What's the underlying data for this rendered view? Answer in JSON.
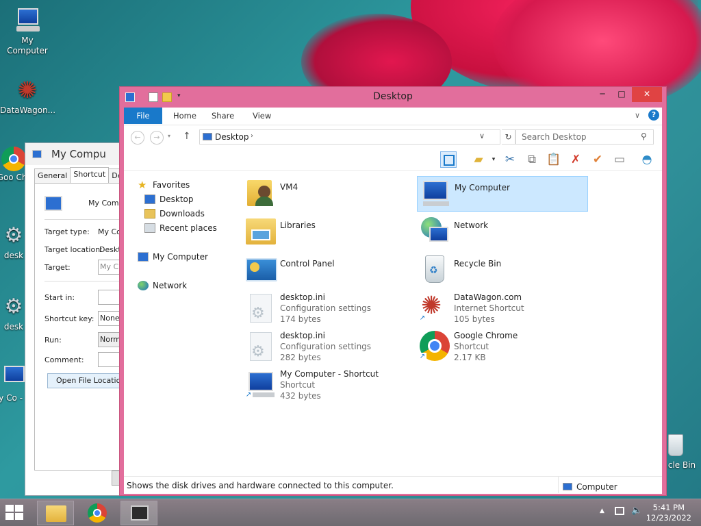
{
  "desktop": {
    "icons": [
      {
        "label": "My Computer",
        "icon": "computer-icon"
      },
      {
        "label": "DataWagon...",
        "icon": "datawagon-shortcut-icon"
      },
      {
        "label": "Goo Chr",
        "icon": "chrome-icon"
      },
      {
        "label": "desk",
        "icon": "settings-file-icon"
      },
      {
        "label": "desk",
        "icon": "settings-file-icon"
      },
      {
        "label": "My Co - Sh",
        "icon": "computer-shortcut-icon"
      },
      {
        "label": "cle Bin",
        "icon": "recycle-bin-icon"
      }
    ]
  },
  "properties": {
    "title": "My Compu",
    "tabs": [
      "General",
      "Shortcut",
      "Det"
    ],
    "name": "My Comp",
    "fields": {
      "target_type_label": "Target type:",
      "target_type": "My Co",
      "target_location_label": "Target location:",
      "target_location": "Deskt",
      "target_label": "Target:",
      "target": "My C",
      "start_in_label": "Start in:",
      "start_in": "",
      "shortcut_key_label": "Shortcut key:",
      "shortcut_key": "None",
      "run_label": "Run:",
      "run": "Norma",
      "comment_label": "Comment:",
      "comment": ""
    },
    "open_location_button": "Open File Location"
  },
  "explorer": {
    "title": "Desktop",
    "ribbon_tabs": [
      "File",
      "Home",
      "Share",
      "View"
    ],
    "address": "Desktop",
    "search_placeholder": "Search Desktop",
    "nav": {
      "favorites": "Favorites",
      "favorites_items": [
        "Desktop",
        "Downloads",
        "Recent places"
      ],
      "my_computer": "My Computer",
      "network": "Network"
    },
    "items": [
      {
        "name": "VM4",
        "type": "",
        "size": "",
        "icon": "user-folder-icon"
      },
      {
        "name": "My Computer",
        "type": "",
        "size": "",
        "icon": "computer-icon"
      },
      {
        "name": "Libraries",
        "type": "",
        "size": "",
        "icon": "libraries-icon"
      },
      {
        "name": "Network",
        "type": "",
        "size": "",
        "icon": "network-icon"
      },
      {
        "name": "Control Panel",
        "type": "",
        "size": "",
        "icon": "control-panel-icon"
      },
      {
        "name": "Recycle Bin",
        "type": "",
        "size": "",
        "icon": "recycle-bin-icon"
      },
      {
        "name": "desktop.ini",
        "type": "Configuration settings",
        "size": "174 bytes",
        "icon": "settings-file-icon"
      },
      {
        "name": "DataWagon.com",
        "type": "Internet Shortcut",
        "size": "105 bytes",
        "icon": "datawagon-shortcut-icon"
      },
      {
        "name": "desktop.ini",
        "type": "Configuration settings",
        "size": "282 bytes",
        "icon": "settings-file-icon"
      },
      {
        "name": "Google Chrome",
        "type": "Shortcut",
        "size": "2.17 KB",
        "icon": "chrome-icon"
      },
      {
        "name": "My Computer - Shortcut",
        "type": "Shortcut",
        "size": "432 bytes",
        "icon": "computer-shortcut-icon"
      }
    ],
    "selected_item": "My Computer",
    "status": "Shows the disk drives and hardware connected to this computer.",
    "status_right": "Computer"
  },
  "taskbar": {
    "time": "5:41 PM",
    "date": "12/23/2022"
  },
  "colors": {
    "window_frame": "#e26e9c",
    "ribbon_file": "#1979ca",
    "selection": "#cce8ff",
    "close_button": "#e04343"
  }
}
